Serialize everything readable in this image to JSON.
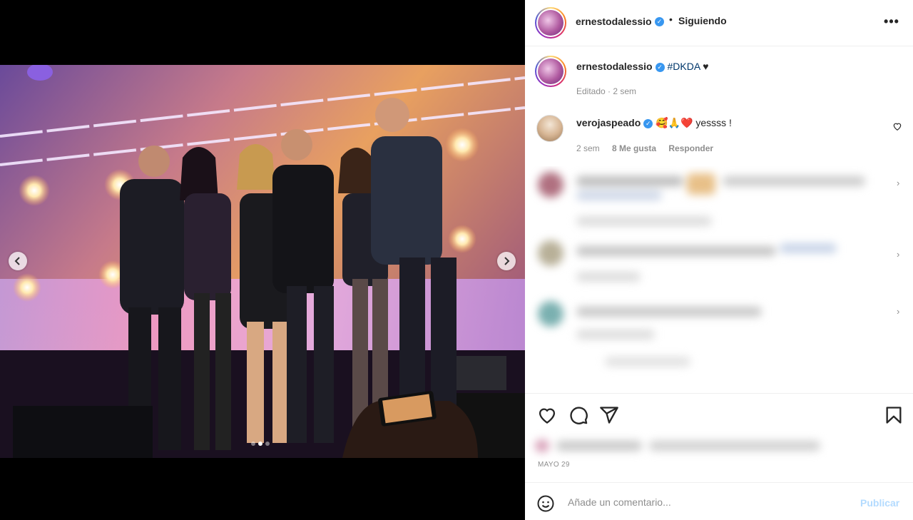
{
  "post": {
    "author": "ernestodalessio",
    "follow_status": "Siguiendo",
    "more_label": "•••",
    "separator": "•"
  },
  "caption": {
    "author": "ernestodalessio",
    "hashtag": "#DKDA",
    "suffix": " ♥",
    "meta": "Editado · 2 sem"
  },
  "comment": {
    "author": "verojaspeado",
    "emojis": "🥰🙏❤️",
    "text": " yessss !",
    "time": "2 sem",
    "likes": "8 Me gusta",
    "reply": "Responder"
  },
  "date": "MAYO 29",
  "composer": {
    "placeholder": "Añade un comentario...",
    "publish": "Publicar"
  },
  "colors": {
    "verified": "#3897f0",
    "hashtag": "#00376b",
    "publish_disabled": "#b3dbff"
  }
}
